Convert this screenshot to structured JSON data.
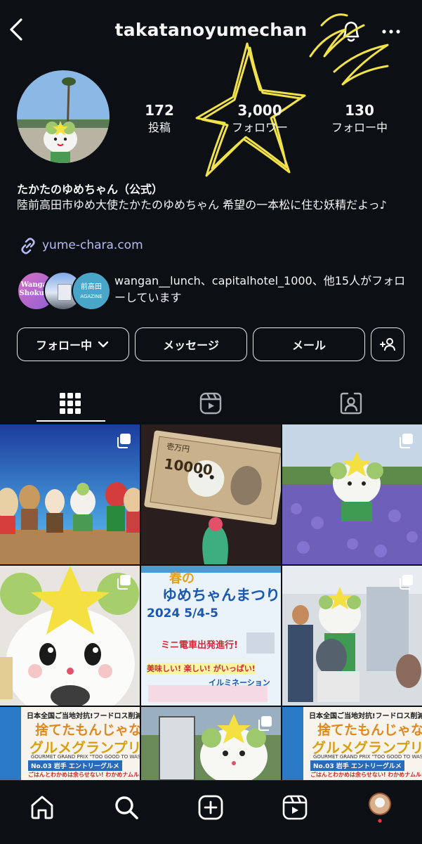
{
  "header": {
    "username": "takatanoyumechan"
  },
  "stats": [
    {
      "value": "172",
      "label": "投稿"
    },
    {
      "value": "3,000",
      "label": "フォロワー"
    },
    {
      "value": "130",
      "label": "フォロー中"
    }
  ],
  "profile": {
    "display_name": "たかたのゆめちゃん（公式）",
    "bio": "陸前高田市ゆめ大使たかたのゆめちゃん 希望の一本松に住む妖精だよっ♪",
    "link": "yume-chara.com"
  },
  "followed_by": {
    "avatar_texts": {
      "a1_line1": "Wangan",
      "a1_line2": "Shokudo",
      "a3_line1": "前高田",
      "a3_line2": "AGAZINE"
    },
    "text": "wangan__lunch、capitalhotel_1000、他15人がフォローしています"
  },
  "buttons": {
    "following": "フォロー中",
    "message": "メッセージ",
    "email": "メール"
  },
  "tabs": [
    "grid",
    "reels",
    "tagged"
  ],
  "grid": {
    "banknote_text": "10000",
    "banknote_small": "壱万円",
    "poster_title": "ゆめちゃんまつり",
    "poster_top": "春の",
    "poster_date": "2024 5/4-5",
    "poster_line1": "ミニ電車出発進行!",
    "poster_line2": "美味しい! 楽しい! がいっぱい!",
    "poster_line3": "イルミネーション",
    "gourmet_line1": "日本全国ご当地対抗!フードロス削減",
    "gourmet_line2": "捨てたもんじゃない!",
    "gourmet_line3": "グルメグランプリ",
    "gourmet_line4": "GOURMET GRAND PRIX \"TOO GOOD TO WASTE\"",
    "gourmet_line5": "No.03 岩手 エントリーグルメ",
    "gourmet_line6": "ごはんとわかめは余らせない! わかめナムルおにぎり"
  },
  "colors": {
    "background": "#0c0f14",
    "link": "#b7bcf2",
    "doodle": "#f2e24a"
  },
  "icons": [
    "chevron-left-icon",
    "bell-icon",
    "more-icon",
    "link-icon",
    "chevron-down-icon",
    "add-person-icon",
    "grid-icon",
    "reels-icon",
    "tagged-icon",
    "home-icon",
    "search-icon",
    "create-icon",
    "reels-nav-icon",
    "profile-avatar"
  ]
}
